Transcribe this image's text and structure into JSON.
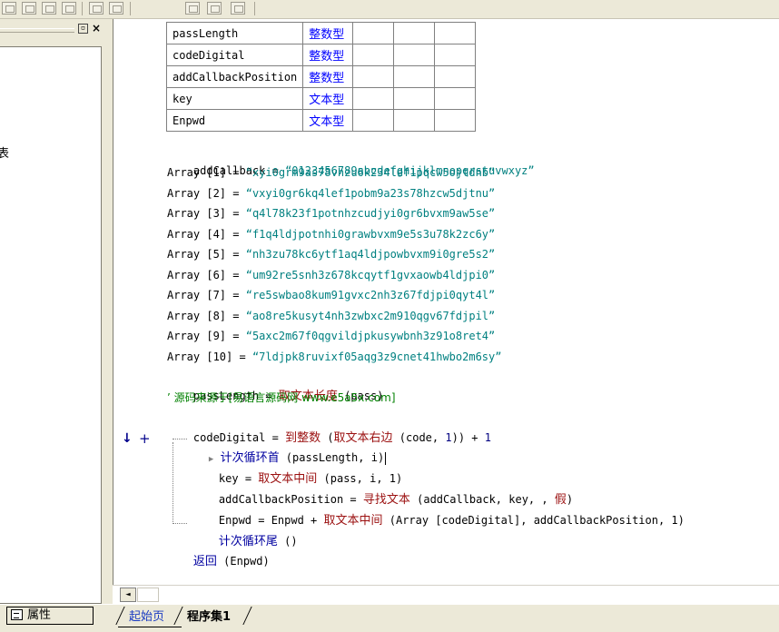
{
  "panel": {
    "side_text": "表",
    "close_glyph": "×"
  },
  "bottom": {
    "properties_tab": "属性",
    "tab_start": "起始页",
    "tab_program": "程序集1"
  },
  "scroll": {
    "left_arrow": "◄"
  },
  "var_table": [
    {
      "name": "passLength",
      "type": "整数型"
    },
    {
      "name": "codeDigital",
      "type": "整数型"
    },
    {
      "name": "addCallbackPosition",
      "type": "整数型"
    },
    {
      "name": "key",
      "type": "文本型"
    },
    {
      "name": "Enpwd",
      "type": "文本型"
    }
  ],
  "code": {
    "add_callback": {
      "lhs": "addCallback",
      "eq": " = ",
      "value": "“0123456789abcdefghijklmnopqrstuvwxyz”"
    },
    "arrays": [
      {
        "lhs": "Array [1]",
        "value": "“xyi0grm9as78vhzu6k234lef1pqcw5ojtdnb”"
      },
      {
        "lhs": "Array [2]",
        "value": "“vxyi0gr6kq4lef1pobm9a23s78hzcw5djtnu”"
      },
      {
        "lhs": "Array [3]",
        "value": "“q4l78k23f1potnhzcudjyi0gr6bvxm9aw5se”"
      },
      {
        "lhs": "Array [4]",
        "value": "“f1q4ldjpotnhi0grawbvxm9e5s3u78k2zc6y”"
      },
      {
        "lhs": "Array [5]",
        "value": "“nh3zu78kc6ytf1aq4ldjpowbvxm9i0gre5s2”"
      },
      {
        "lhs": "Array [6]",
        "value": "“um92re5snh3z678kcqytf1gvxaowb4ldjpi0”"
      },
      {
        "lhs": "Array [7]",
        "value": "“re5swbao8kum91gvxc2nh3z67fdjpi0qyt4l”"
      },
      {
        "lhs": "Array [8]",
        "value": "“ao8re5kusyt4nh3zwbxc2m910qgv67fdjpil”"
      },
      {
        "lhs": "Array [9]",
        "value": "“5axc2m67f0qgvildjpkusywbnh3z91o8ret4”"
      },
      {
        "lhs": "Array [10]",
        "value": "“7ldjpk8ruvixf05aqg3z9cnet41hwbo2m6sy”"
      }
    ],
    "pass_length": {
      "lhs": "passLength",
      "eq": " = ",
      "fn": "取文本长度",
      "args": " (pass)"
    },
    "comment": "’ 源码来源于[易语言源码网 www.e5a5x.com]",
    "code_digital": {
      "lhs": "codeDigital",
      "eq": " = ",
      "fn1": "到整数",
      "p1": " (",
      "fn2": "取文本右边",
      "args": " (code, ",
      "num": "1",
      "tail": "))",
      "plus": " + ",
      "num2": "1"
    },
    "loop_head": {
      "fn": "计次循环首",
      "args": " (passLength, i)"
    },
    "key_line": {
      "lhs": "key",
      "eq": " = ",
      "fn": "取文本中间",
      "args": " (pass, i, 1)"
    },
    "pos_line": {
      "lhs": "addCallbackPosition",
      "eq": " = ",
      "fn": "寻找文本",
      "args": " (addCallback, key, , ",
      "fval": "假",
      "close": ")"
    },
    "enpwd_line": {
      "lhs": "Enpwd",
      "eq": " = Enpwd + ",
      "fn": "取文本中间",
      "args": " (Array [codeDigital], addCallbackPosition, 1)"
    },
    "loop_tail": {
      "fn": "计次循环尾",
      "args": " ()"
    },
    "ret": {
      "fn": "返回",
      "args": " (Enpwd)"
    },
    "markers": {
      "arrow": "↓",
      "plus": "+"
    }
  }
}
